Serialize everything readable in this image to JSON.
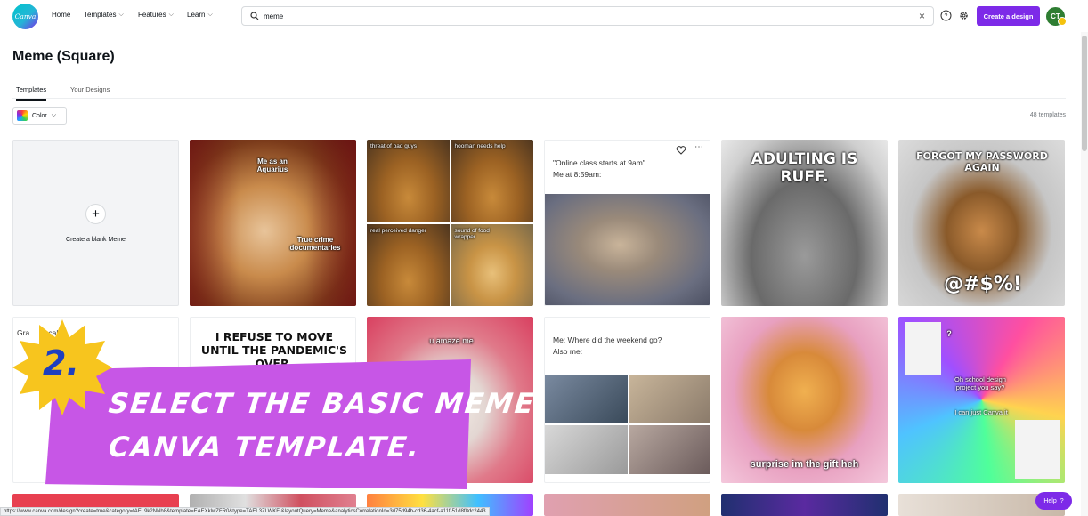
{
  "logo": {
    "text": "Canva"
  },
  "nav": {
    "items": [
      {
        "label": "Home",
        "chevron": false
      },
      {
        "label": "Templates",
        "chevron": true
      },
      {
        "label": "Features",
        "chevron": true
      },
      {
        "label": "Learn",
        "chevron": true
      }
    ]
  },
  "search": {
    "value": "meme"
  },
  "toolbar": {
    "create_label": "Create a design",
    "avatar_initials": "CT"
  },
  "page": {
    "title": "Meme (Square)"
  },
  "tabs": [
    {
      "label": "Templates",
      "active": true
    },
    {
      "label": "Your Designs",
      "active": false
    }
  ],
  "filter": {
    "color_label": "Color"
  },
  "results": {
    "count": "48 templates"
  },
  "blank": {
    "label": "Create a blank Meme"
  },
  "templates": {
    "cat_top": "Me as an Aquarius",
    "cat_bottom": "True crime documentaries",
    "dog_grid": [
      "threat of bad guys",
      "hooman needs help",
      "real perceived danger",
      "sound of food wrapper"
    ],
    "online_class": "\"Online class starts at 9am\"\nMe at 8:59am:",
    "adulting": "ADULTING IS RUFF.",
    "forgot_top": "FORGOT MY PASSWORD AGAIN",
    "forgot_bottom": "@#$%!",
    "partial_left": "Gra      o call.",
    "refuse": "I REFUSE TO MOVE UNTIL THE PANDEMIC'S OVER.",
    "amaze": "u amaze me",
    "weekend": "Me: Where did the weekend go?\nAlso me:",
    "surprise": "surprise im the gift heh",
    "school": "Oh school design project you say?",
    "canva_it": "I can just Canva it",
    "question_marks": "?"
  },
  "overlay": {
    "step_number": "2.",
    "line1": "SELECT THE BASIC MEME",
    "line2": "CANVA TEMPLATE."
  },
  "status_bar": {
    "url": "https://www.canva.com/design?create=true&category=tAEL9k2NNb8&template=EAEXklwZFR0&type=TAEL3ZLWKFI&layoutQuery=Meme&analyticsCorrelationId=3d75d94b-cd36-4acf-a11f-51d8f8dc2443"
  },
  "help": {
    "label": "Help",
    "icon": "?"
  },
  "colors": {
    "brand": "#7d2ae8",
    "overlay": "#c756e6",
    "sun": "#f7c51e"
  }
}
